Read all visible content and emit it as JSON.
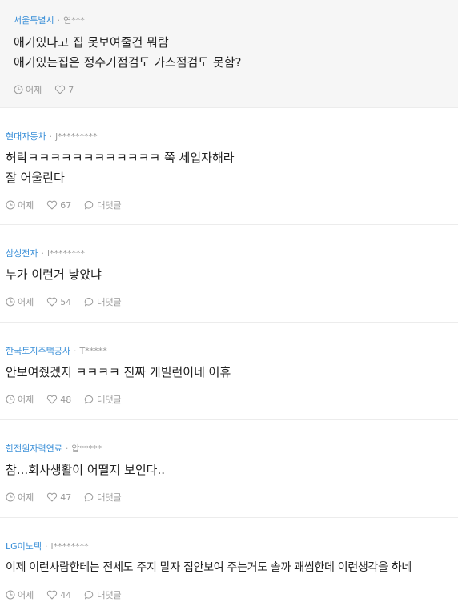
{
  "comments": [
    {
      "company": "서울특별시",
      "user": "연***",
      "lines": [
        "애기있다고 집 못보여줄건 뭐람",
        "애기있는집은 정수기점검도 가스점검도 못함?"
      ],
      "time": "어제",
      "likes": "7",
      "reply_label": ""
    },
    {
      "company": "현대자동차",
      "user": "j*********",
      "lines": [
        "허락ㅋㅋㅋㅋㅋㅋㅋㅋㅋㅋㅋㅋ 쭉 세입자해라",
        "잘 어울린다"
      ],
      "time": "어제",
      "likes": "67",
      "reply_label": "대댓글"
    },
    {
      "company": "삼성전자",
      "user": "l********",
      "lines": [
        "누가 이런거 낳았냐"
      ],
      "time": "어제",
      "likes": "54",
      "reply_label": "대댓글"
    },
    {
      "company": "한국토지주택공사",
      "user": "T*****",
      "lines": [
        "안보여줬겠지 ㅋㅋㅋㅋ 진짜 개빌런이네 어휴"
      ],
      "time": "어제",
      "likes": "48",
      "reply_label": "대댓글"
    },
    {
      "company": "한전원자력연료",
      "user": "압*****",
      "lines": [
        "참...회사생활이 어떨지 보인다.."
      ],
      "time": "어제",
      "likes": "47",
      "reply_label": "대댓글"
    },
    {
      "company": "LG이노텍",
      "user": "l********",
      "lines": [
        "이제 이런사람한테는 전세도 주지 말자 집안보여 주는거도 솔까 괘씸한데 이런생각을 하네"
      ],
      "time": "어제",
      "likes": "44",
      "reply_label": "대댓글"
    }
  ]
}
